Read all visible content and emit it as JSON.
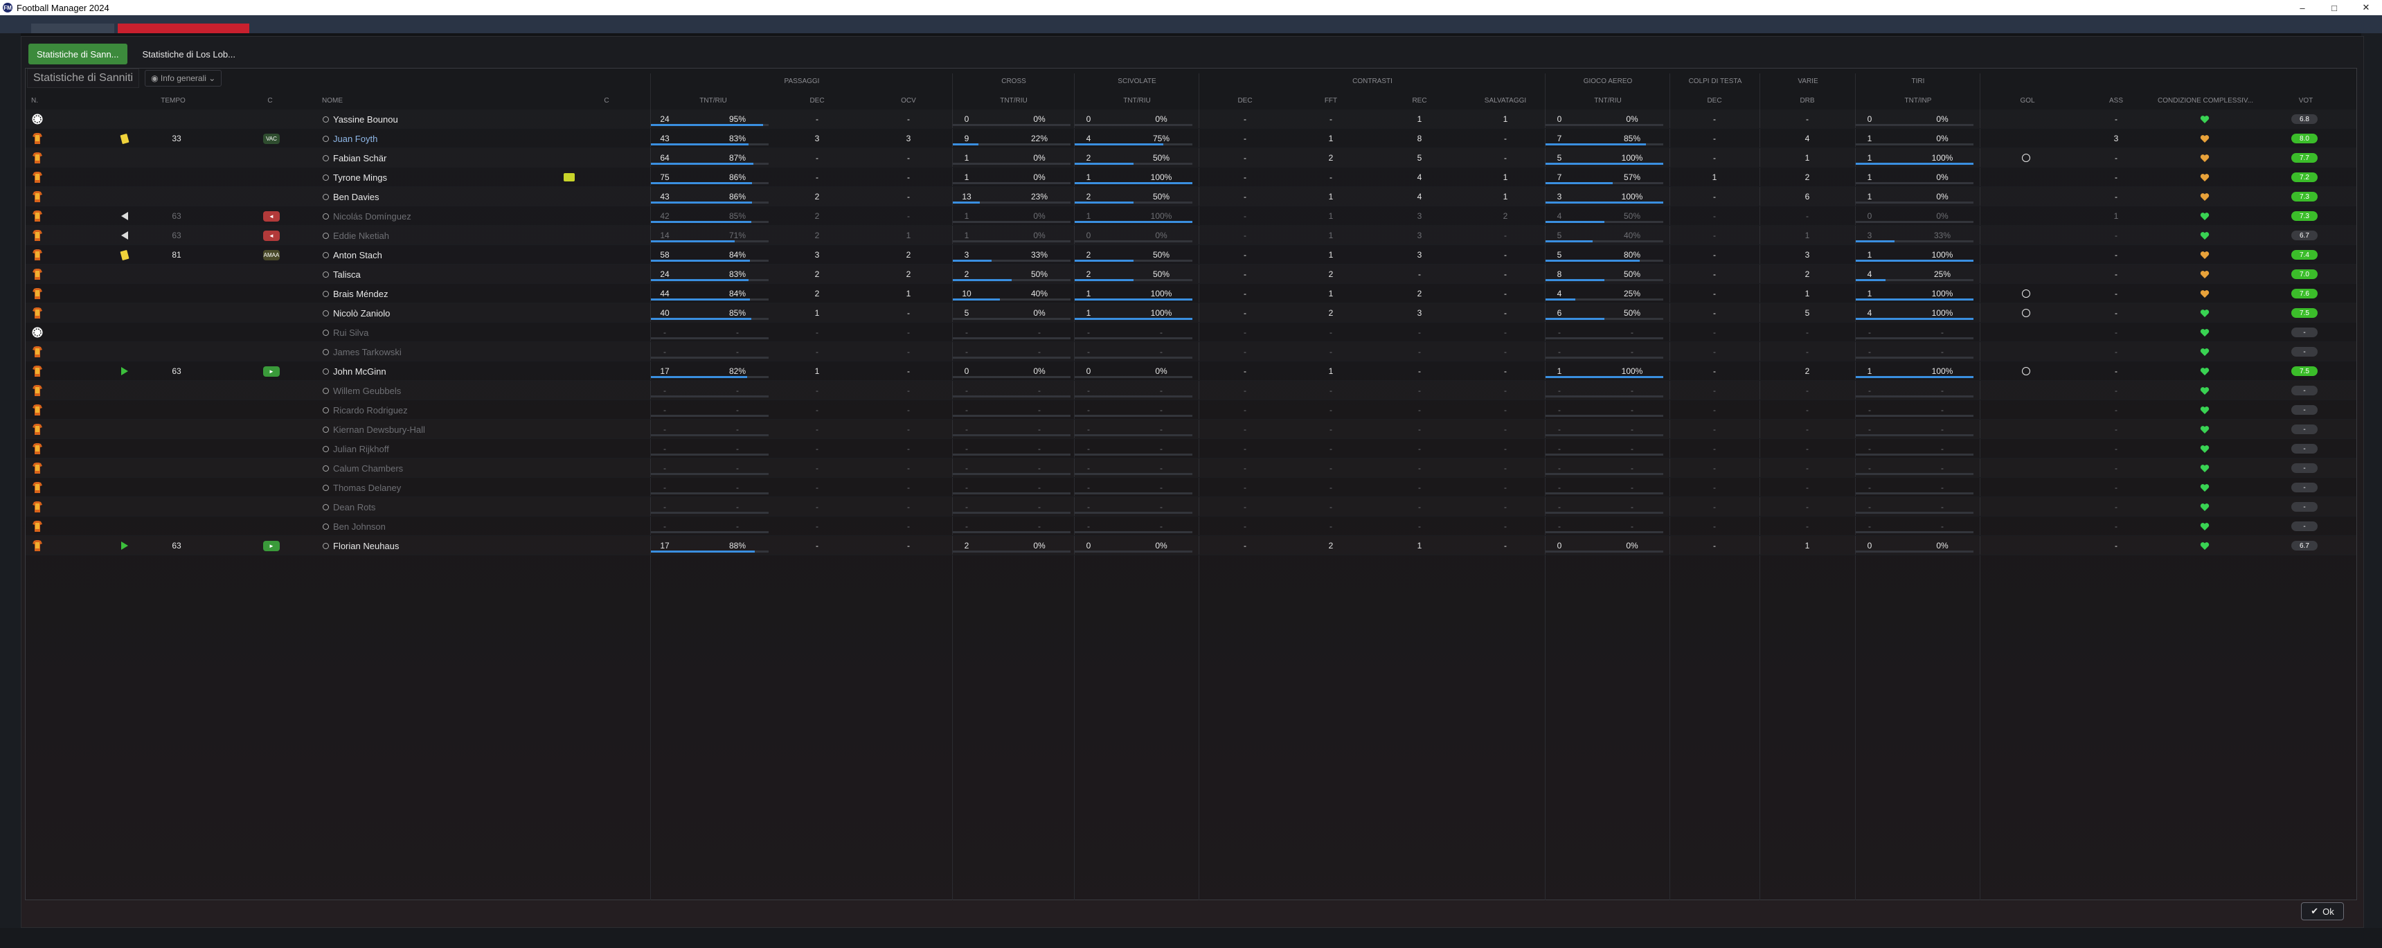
{
  "window": {
    "title": "Football Manager 2024",
    "minimize": "–",
    "maximize": "□",
    "close": "✕"
  },
  "tabs": [
    {
      "label": "Statistiche di Sann..."
    },
    {
      "label": "Statistiche di Los Lob..."
    }
  ],
  "subbar": {
    "team_label": "Statistiche di Sanniti",
    "view_dropdown": "Info generali"
  },
  "groups": {
    "passaggi": "PASSAGGI",
    "cross": "CROSS",
    "scivolate": "SCIVOLATE",
    "contrasti": "CONTRASTI",
    "gioco_aereo": "GIOCO AEREO",
    "colpi_testa": "COLPI DI TESTA",
    "varie": "VARIE",
    "tiri": "TIRI"
  },
  "headers": {
    "num": "N.",
    "tempo": "TEMPO",
    "c1": "C",
    "nome": "NOME",
    "c2": "C",
    "pass_tnt": "TNT/RIU",
    "pass_dec": "DEC",
    "pass_ocv": "OCV",
    "cross_tnt": "TNT/RIU",
    "sciv_tnt": "TNT/RIU",
    "contr_dec": "DEC",
    "contr_fft": "FFT",
    "contr_rec": "REC",
    "contr_salv": "SALVATAGGI",
    "aereo_tnt": "TNT/RIU",
    "testa_dec": "DEC",
    "varie_drb": "DRB",
    "tiri_tnt": "TNT/INP",
    "gol": "GOL",
    "ass": "ASS",
    "condizione": "CONDIZIONE COMPLESSIV...",
    "voto": "VOT"
  },
  "ok_label": "Ok",
  "players": [
    {
      "shirt": "gk",
      "event": "",
      "min": "",
      "pos": "",
      "name": "Yassine Bounou",
      "dim": false,
      "link": false,
      "capt": false,
      "p_t": "24",
      "p_p": "95%",
      "p_v": 95,
      "p_dec": "-",
      "p_ocv": "-",
      "c_t": "0",
      "c_p": "0%",
      "c_v": 0,
      "s_t": "0",
      "s_p": "0%",
      "s_v": 0,
      "k_dec": "-",
      "k_fft": "-",
      "k_rec": "1",
      "k_salv": "1",
      "a_t": "0",
      "a_p": "0%",
      "a_v": 0,
      "h_dec": "-",
      "drb": "-",
      "t_t": "0",
      "t_p": "0%",
      "t_v": 0,
      "gol": "",
      "ass": "-",
      "rating": "6.8",
      "rc": "#3a3b40"
    },
    {
      "shirt": "out",
      "event": "yellow",
      "min": "33",
      "pos": "VAC",
      "pc": "#2f4d2f",
      "name": "Juan Foyth",
      "dim": false,
      "link": true,
      "capt": false,
      "p_t": "43",
      "p_p": "83%",
      "p_v": 83,
      "p_dec": "3",
      "p_ocv": "3",
      "c_t": "9",
      "c_p": "22%",
      "c_v": 22,
      "s_t": "4",
      "s_p": "75%",
      "s_v": 75,
      "k_dec": "-",
      "k_fft": "1",
      "k_rec": "8",
      "k_salv": "-",
      "a_t": "7",
      "a_p": "85%",
      "a_v": 85,
      "h_dec": "-",
      "drb": "4",
      "t_t": "1",
      "t_p": "0%",
      "t_v": 0,
      "gol": "",
      "ass": "3",
      "rating": "8.0",
      "rc": "#3bbd2a"
    },
    {
      "shirt": "out",
      "event": "",
      "min": "",
      "pos": "",
      "name": "Fabian Schär",
      "dim": false,
      "link": false,
      "capt": false,
      "p_t": "64",
      "p_p": "87%",
      "p_v": 87,
      "p_dec": "-",
      "p_ocv": "-",
      "c_t": "1",
      "c_p": "0%",
      "c_v": 0,
      "s_t": "2",
      "s_p": "50%",
      "s_v": 50,
      "k_dec": "-",
      "k_fft": "2",
      "k_rec": "5",
      "k_salv": "-",
      "a_t": "5",
      "a_p": "100%",
      "a_v": 100,
      "h_dec": "-",
      "drb": "1",
      "t_t": "1",
      "t_p": "100%",
      "t_v": 100,
      "gol": "g",
      "ass": "-",
      "rating": "7.7",
      "rc": "#3bbd2a"
    },
    {
      "shirt": "out",
      "event": "",
      "min": "",
      "pos": "",
      "name": "Tyrone Mings",
      "dim": false,
      "link": false,
      "capt": true,
      "p_t": "75",
      "p_p": "86%",
      "p_v": 86,
      "p_dec": "-",
      "p_ocv": "-",
      "c_t": "1",
      "c_p": "0%",
      "c_v": 0,
      "s_t": "1",
      "s_p": "100%",
      "s_v": 100,
      "k_dec": "-",
      "k_fft": "-",
      "k_rec": "4",
      "k_salv": "1",
      "a_t": "7",
      "a_p": "57%",
      "a_v": 57,
      "h_dec": "1",
      "drb": "2",
      "t_t": "1",
      "t_p": "0%",
      "t_v": 0,
      "gol": "",
      "ass": "-",
      "rating": "7.2",
      "rc": "#3bbd2a"
    },
    {
      "shirt": "out",
      "event": "",
      "min": "",
      "pos": "",
      "name": "Ben Davies",
      "dim": false,
      "link": false,
      "capt": false,
      "p_t": "43",
      "p_p": "86%",
      "p_v": 86,
      "p_dec": "2",
      "p_ocv": "-",
      "c_t": "13",
      "c_p": "23%",
      "c_v": 23,
      "s_t": "2",
      "s_p": "50%",
      "s_v": 50,
      "k_dec": "-",
      "k_fft": "1",
      "k_rec": "4",
      "k_salv": "1",
      "a_t": "3",
      "a_p": "100%",
      "a_v": 100,
      "h_dec": "-",
      "drb": "6",
      "t_t": "1",
      "t_p": "0%",
      "t_v": 0,
      "gol": "",
      "ass": "-",
      "rating": "7.3",
      "rc": "#3bbd2a"
    },
    {
      "shirt": "out",
      "event": "off",
      "min": "63",
      "pos": "◄",
      "pc": "#b23a3a",
      "name": "Nicolás Domínguez",
      "dim": true,
      "link": false,
      "capt": false,
      "p_t": "42",
      "p_p": "85%",
      "p_v": 85,
      "p_dec": "2",
      "p_ocv": "-",
      "c_t": "1",
      "c_p": "0%",
      "c_v": 0,
      "s_t": "1",
      "s_p": "100%",
      "s_v": 100,
      "k_dec": "-",
      "k_fft": "1",
      "k_rec": "3",
      "k_salv": "2",
      "a_t": "4",
      "a_p": "50%",
      "a_v": 50,
      "h_dec": "-",
      "drb": "-",
      "t_t": "0",
      "t_p": "0%",
      "t_v": 0,
      "gol": "",
      "ass": "1",
      "rating": "7.3",
      "rc": "#3bbd2a"
    },
    {
      "shirt": "out",
      "event": "off",
      "min": "63",
      "pos": "◄",
      "pc": "#b23a3a",
      "name": "Eddie Nketiah",
      "dim": true,
      "link": false,
      "capt": false,
      "p_t": "14",
      "p_p": "71%",
      "p_v": 71,
      "p_dec": "2",
      "p_ocv": "1",
      "c_t": "1",
      "c_p": "0%",
      "c_v": 0,
      "s_t": "0",
      "s_p": "0%",
      "s_v": 0,
      "k_dec": "-",
      "k_fft": "1",
      "k_rec": "3",
      "k_salv": "-",
      "a_t": "5",
      "a_p": "40%",
      "a_v": 40,
      "h_dec": "-",
      "drb": "1",
      "t_t": "3",
      "t_p": "33%",
      "t_v": 33,
      "gol": "",
      "ass": "-",
      "rating": "6.7",
      "rc": "#3a3b40"
    },
    {
      "shirt": "out",
      "event": "yellow",
      "min": "81",
      "pos": "AMAA",
      "pc": "#4a4a2a",
      "name": "Anton Stach",
      "dim": false,
      "link": false,
      "capt": false,
      "p_t": "58",
      "p_p": "84%",
      "p_v": 84,
      "p_dec": "3",
      "p_ocv": "2",
      "c_t": "3",
      "c_p": "33%",
      "c_v": 33,
      "s_t": "2",
      "s_p": "50%",
      "s_v": 50,
      "k_dec": "-",
      "k_fft": "1",
      "k_rec": "3",
      "k_salv": "-",
      "a_t": "5",
      "a_p": "80%",
      "a_v": 80,
      "h_dec": "-",
      "drb": "3",
      "t_t": "1",
      "t_p": "100%",
      "t_v": 100,
      "gol": "",
      "ass": "-",
      "rating": "7.4",
      "rc": "#3bbd2a"
    },
    {
      "shirt": "out",
      "event": "",
      "min": "",
      "pos": "",
      "name": "Talisca",
      "dim": false,
      "link": false,
      "capt": false,
      "p_t": "24",
      "p_p": "83%",
      "p_v": 83,
      "p_dec": "2",
      "p_ocv": "2",
      "c_t": "2",
      "c_p": "50%",
      "c_v": 50,
      "s_t": "2",
      "s_p": "50%",
      "s_v": 50,
      "k_dec": "-",
      "k_fft": "2",
      "k_rec": "-",
      "k_salv": "-",
      "a_t": "8",
      "a_p": "50%",
      "a_v": 50,
      "h_dec": "-",
      "drb": "2",
      "t_t": "4",
      "t_p": "25%",
      "t_v": 25,
      "gol": "",
      "ass": "-",
      "rating": "7.0",
      "rc": "#3bbd2a"
    },
    {
      "shirt": "out",
      "event": "",
      "min": "",
      "pos": "",
      "name": "Brais Méndez",
      "dim": false,
      "link": false,
      "capt": false,
      "p_t": "44",
      "p_p": "84%",
      "p_v": 84,
      "p_dec": "2",
      "p_ocv": "1",
      "c_t": "10",
      "c_p": "40%",
      "c_v": 40,
      "s_t": "1",
      "s_p": "100%",
      "s_v": 100,
      "k_dec": "-",
      "k_fft": "1",
      "k_rec": "2",
      "k_salv": "-",
      "a_t": "4",
      "a_p": "25%",
      "a_v": 25,
      "h_dec": "-",
      "drb": "1",
      "t_t": "1",
      "t_p": "100%",
      "t_v": 100,
      "gol": "g",
      "ass": "-",
      "rating": "7.6",
      "rc": "#3bbd2a"
    },
    {
      "shirt": "out",
      "event": "",
      "min": "",
      "pos": "",
      "name": "Nicolò Zaniolo",
      "dim": false,
      "link": false,
      "capt": false,
      "p_t": "40",
      "p_p": "85%",
      "p_v": 85,
      "p_dec": "1",
      "p_ocv": "-",
      "c_t": "5",
      "c_p": "0%",
      "c_v": 0,
      "s_t": "1",
      "s_p": "100%",
      "s_v": 100,
      "k_dec": "-",
      "k_fft": "2",
      "k_rec": "3",
      "k_salv": "-",
      "a_t": "6",
      "a_p": "50%",
      "a_v": 50,
      "h_dec": "-",
      "drb": "5",
      "t_t": "4",
      "t_p": "100%",
      "t_v": 100,
      "gol": "g",
      "ass": "-",
      "rating": "7.5",
      "rc": "#3bbd2a"
    },
    {
      "shirt": "gk",
      "event": "",
      "min": "",
      "pos": "",
      "name": "Rui Silva",
      "dim": true,
      "link": false,
      "capt": false,
      "empty": true,
      "rating": "-",
      "rc": "#3a3b40"
    },
    {
      "shirt": "out",
      "event": "",
      "min": "",
      "pos": "",
      "name": "James Tarkowski",
      "dim": true,
      "link": false,
      "capt": false,
      "empty": true,
      "rating": "-",
      "rc": "#3a3b40"
    },
    {
      "shirt": "out",
      "event": "on",
      "min": "63",
      "pos": "►",
      "pc": "#3a9a3a",
      "name": "John McGinn",
      "dim": false,
      "link": false,
      "capt": false,
      "p_t": "17",
      "p_p": "82%",
      "p_v": 82,
      "p_dec": "1",
      "p_ocv": "-",
      "c_t": "0",
      "c_p": "0%",
      "c_v": 0,
      "s_t": "0",
      "s_p": "0%",
      "s_v": 0,
      "k_dec": "-",
      "k_fft": "1",
      "k_rec": "-",
      "k_salv": "-",
      "a_t": "1",
      "a_p": "100%",
      "a_v": 100,
      "h_dec": "-",
      "drb": "2",
      "t_t": "1",
      "t_p": "100%",
      "t_v": 100,
      "gol": "g",
      "ass": "-",
      "rating": "7.5",
      "rc": "#3bbd2a"
    },
    {
      "shirt": "out",
      "event": "",
      "min": "",
      "pos": "",
      "name": "Willem Geubbels",
      "dim": true,
      "empty": true,
      "rating": "-",
      "rc": "#3a3b40"
    },
    {
      "shirt": "out",
      "event": "",
      "min": "",
      "pos": "",
      "name": "Ricardo Rodriguez",
      "dim": true,
      "empty": true,
      "rating": "-",
      "rc": "#3a3b40"
    },
    {
      "shirt": "out",
      "event": "",
      "min": "",
      "pos": "",
      "name": "Kiernan Dewsbury-Hall",
      "dim": true,
      "empty": true,
      "rating": "-",
      "rc": "#3a3b40"
    },
    {
      "shirt": "out",
      "event": "",
      "min": "",
      "pos": "",
      "name": "Julian Rijkhoff",
      "dim": true,
      "empty": true,
      "rating": "-",
      "rc": "#3a3b40"
    },
    {
      "shirt": "out",
      "event": "",
      "min": "",
      "pos": "",
      "name": "Calum Chambers",
      "dim": true,
      "empty": true,
      "rating": "-",
      "rc": "#3a3b40"
    },
    {
      "shirt": "out",
      "event": "",
      "min": "",
      "pos": "",
      "name": "Thomas Delaney",
      "dim": true,
      "empty": true,
      "rating": "-",
      "rc": "#3a3b40"
    },
    {
      "shirt": "out",
      "event": "",
      "min": "",
      "pos": "",
      "name": "Dean Rots",
      "dim": true,
      "empty": true,
      "rating": "-",
      "rc": "#3a3b40"
    },
    {
      "shirt": "out",
      "event": "",
      "min": "",
      "pos": "",
      "name": "Ben Johnson",
      "dim": true,
      "empty": true,
      "rating": "-",
      "rc": "#3a3b40"
    },
    {
      "shirt": "out",
      "event": "on",
      "min": "63",
      "pos": "►",
      "pc": "#3a9a3a",
      "name": "Florian Neuhaus",
      "dim": false,
      "link": false,
      "capt": false,
      "p_t": "17",
      "p_p": "88%",
      "p_v": 88,
      "p_dec": "-",
      "p_ocv": "-",
      "c_t": "2",
      "c_p": "0%",
      "c_v": 0,
      "s_t": "0",
      "s_p": "0%",
      "s_v": 0,
      "k_dec": "-",
      "k_fft": "2",
      "k_rec": "1",
      "k_salv": "-",
      "a_t": "0",
      "a_p": "0%",
      "a_v": 0,
      "h_dec": "-",
      "drb": "1",
      "t_t": "0",
      "t_p": "0%",
      "t_v": 0,
      "gol": "",
      "ass": "-",
      "rating": "6.7",
      "rc": "#3a3b40"
    }
  ],
  "colors": {
    "bar": "#3a8fe0",
    "heart": "#39d353",
    "accent_green": "#3c8a3c"
  }
}
